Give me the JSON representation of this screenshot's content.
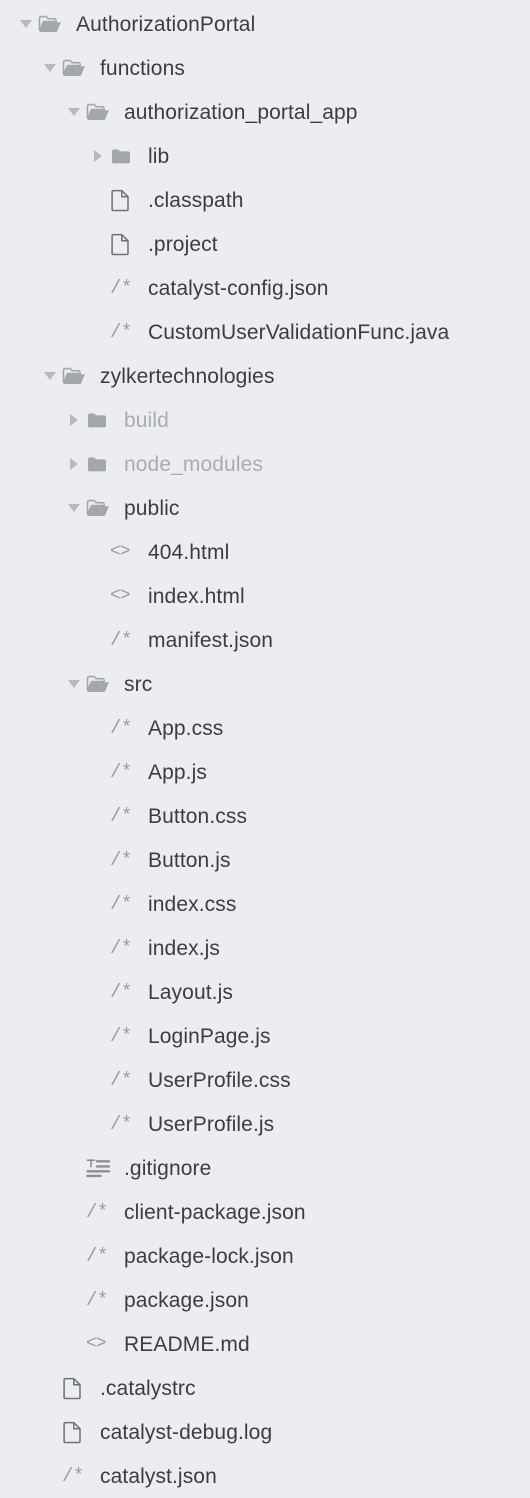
{
  "tree": {
    "name": "project-file-explorer",
    "rows": [
      {
        "label": "AuthorizationPortal",
        "depth": 0,
        "kind": "folder",
        "state": "expanded",
        "icon": "folder-open-icon",
        "dimmed": false
      },
      {
        "label": "functions",
        "depth": 1,
        "kind": "folder",
        "state": "expanded",
        "icon": "folder-open-icon",
        "dimmed": false
      },
      {
        "label": "authorization_portal_app",
        "depth": 2,
        "kind": "folder",
        "state": "expanded",
        "icon": "folder-open-icon",
        "dimmed": false
      },
      {
        "label": "lib",
        "depth": 3,
        "kind": "folder",
        "state": "collapsed",
        "icon": "folder-closed-icon",
        "dimmed": false
      },
      {
        "label": ".classpath",
        "depth": 3,
        "kind": "file",
        "state": "none",
        "icon": "document-icon",
        "dimmed": false
      },
      {
        "label": ".project",
        "depth": 3,
        "kind": "file",
        "state": "none",
        "icon": "document-icon",
        "dimmed": false
      },
      {
        "label": "catalyst-config.json",
        "depth": 3,
        "kind": "file",
        "state": "none",
        "icon": "code-comment-icon",
        "dimmed": false
      },
      {
        "label": "CustomUserValidationFunc.java",
        "depth": 3,
        "kind": "file",
        "state": "none",
        "icon": "code-comment-icon",
        "dimmed": false
      },
      {
        "label": "zylkertechnologies",
        "depth": 1,
        "kind": "folder",
        "state": "expanded",
        "icon": "folder-open-icon",
        "dimmed": false
      },
      {
        "label": "build",
        "depth": 2,
        "kind": "folder",
        "state": "collapsed",
        "icon": "folder-closed-icon",
        "dimmed": true
      },
      {
        "label": "node_modules",
        "depth": 2,
        "kind": "folder",
        "state": "collapsed",
        "icon": "folder-closed-icon",
        "dimmed": true
      },
      {
        "label": "public",
        "depth": 2,
        "kind": "folder",
        "state": "expanded",
        "icon": "folder-open-icon",
        "dimmed": false
      },
      {
        "label": "404.html",
        "depth": 3,
        "kind": "file",
        "state": "none",
        "icon": "angle-brackets-icon",
        "dimmed": false
      },
      {
        "label": "index.html",
        "depth": 3,
        "kind": "file",
        "state": "none",
        "icon": "angle-brackets-icon",
        "dimmed": false
      },
      {
        "label": "manifest.json",
        "depth": 3,
        "kind": "file",
        "state": "none",
        "icon": "code-comment-icon",
        "dimmed": false
      },
      {
        "label": "src",
        "depth": 2,
        "kind": "folder",
        "state": "expanded",
        "icon": "folder-open-icon",
        "dimmed": false
      },
      {
        "label": "App.css",
        "depth": 3,
        "kind": "file",
        "state": "none",
        "icon": "code-comment-icon",
        "dimmed": false
      },
      {
        "label": "App.js",
        "depth": 3,
        "kind": "file",
        "state": "none",
        "icon": "code-comment-icon",
        "dimmed": false
      },
      {
        "label": "Button.css",
        "depth": 3,
        "kind": "file",
        "state": "none",
        "icon": "code-comment-icon",
        "dimmed": false
      },
      {
        "label": "Button.js",
        "depth": 3,
        "kind": "file",
        "state": "none",
        "icon": "code-comment-icon",
        "dimmed": false
      },
      {
        "label": "index.css",
        "depth": 3,
        "kind": "file",
        "state": "none",
        "icon": "code-comment-icon",
        "dimmed": false
      },
      {
        "label": "index.js",
        "depth": 3,
        "kind": "file",
        "state": "none",
        "icon": "code-comment-icon",
        "dimmed": false
      },
      {
        "label": "Layout.js",
        "depth": 3,
        "kind": "file",
        "state": "none",
        "icon": "code-comment-icon",
        "dimmed": false
      },
      {
        "label": "LoginPage.js",
        "depth": 3,
        "kind": "file",
        "state": "none",
        "icon": "code-comment-icon",
        "dimmed": false
      },
      {
        "label": "UserProfile.css",
        "depth": 3,
        "kind": "file",
        "state": "none",
        "icon": "code-comment-icon",
        "dimmed": false
      },
      {
        "label": "UserProfile.js",
        "depth": 3,
        "kind": "file",
        "state": "none",
        "icon": "code-comment-icon",
        "dimmed": false
      },
      {
        "label": ".gitignore",
        "depth": 2,
        "kind": "file",
        "state": "none",
        "icon": "text-lines-icon",
        "dimmed": false
      },
      {
        "label": "client-package.json",
        "depth": 2,
        "kind": "file",
        "state": "none",
        "icon": "code-comment-icon",
        "dimmed": false
      },
      {
        "label": "package-lock.json",
        "depth": 2,
        "kind": "file",
        "state": "none",
        "icon": "code-comment-icon",
        "dimmed": false
      },
      {
        "label": "package.json",
        "depth": 2,
        "kind": "file",
        "state": "none",
        "icon": "code-comment-icon",
        "dimmed": false
      },
      {
        "label": "README.md",
        "depth": 2,
        "kind": "file",
        "state": "none",
        "icon": "angle-brackets-icon",
        "dimmed": false
      },
      {
        "label": ".catalystrc",
        "depth": 1,
        "kind": "file",
        "state": "none",
        "icon": "document-icon",
        "dimmed": false
      },
      {
        "label": "catalyst-debug.log",
        "depth": 1,
        "kind": "file",
        "state": "none",
        "icon": "document-icon",
        "dimmed": false
      },
      {
        "label": "catalyst.json",
        "depth": 1,
        "kind": "file",
        "state": "none",
        "icon": "code-comment-icon",
        "dimmed": false
      }
    ]
  },
  "glyphs": {
    "code-comment-icon": "/*",
    "angle-brackets-icon": "<>"
  },
  "colors": {
    "background": "#ebedf0",
    "label": "#3b3d40",
    "label_dimmed": "#a9acb1",
    "icon": "#a3a6ab",
    "arrow": "#b6b9bd",
    "document_outline": "#6e7276"
  }
}
